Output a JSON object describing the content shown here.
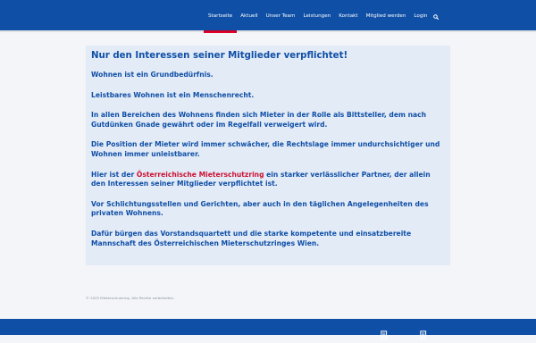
{
  "nav": {
    "items": [
      {
        "label": "Startseite",
        "active": true
      },
      {
        "label": "Aktuell"
      },
      {
        "label": "Unser Team"
      },
      {
        "label": "Leistungen"
      },
      {
        "label": "Kontakt"
      },
      {
        "label": "Mitglied werden"
      },
      {
        "label": "Login"
      }
    ],
    "search_icon": "search-icon"
  },
  "content": {
    "headline": "Nur den Interessen seiner Mitglieder verpflichtet!",
    "p1": "Wohnen ist ein Grundbedürfnis.",
    "p2": "Leistbares Wohnen ist ein Menschenrecht.",
    "p3": "In allen Bereichen des Wohnens finden sich Mieter in der Rolle als Bittsteller, dem nach Gutdünken Gnade gewährt oder im Regelfall verweigert wird.",
    "p4": "Die Position der Mieter wird immer schwächer, die Rechtslage immer undurchsichtiger und Wohnen immer unleistbarer.",
    "p5_before": "Hier ist der ",
    "p5_highlight": "Österreichische Mieterschutzring",
    "p5_after": " ein starker verlässlicher Partner, der allein den Interessen seiner Mitglieder verpflichtet ist.",
    "p6": "Vor Schlichtungsstellen und Gerichten, aber auch in den täglichen Angelegenheiten des privaten Wohnens.",
    "p7": "Dafür bürgen das Vorstandsquartett und die starke kompetente und einsatzbereite Mannschaft des Österreichischen Mieterschutzringes Wien."
  },
  "footer": {
    "copyright": "© 2025 Mieterschutzring. Alle Rechte vorbehalten.",
    "icons": [
      "document-icon",
      "document-icon"
    ]
  },
  "colors": {
    "brand_blue": "#0f4fa6",
    "accent_red": "#e3002b",
    "content_bg": "#e3ebf7",
    "highlight_red": "#cc1131"
  }
}
